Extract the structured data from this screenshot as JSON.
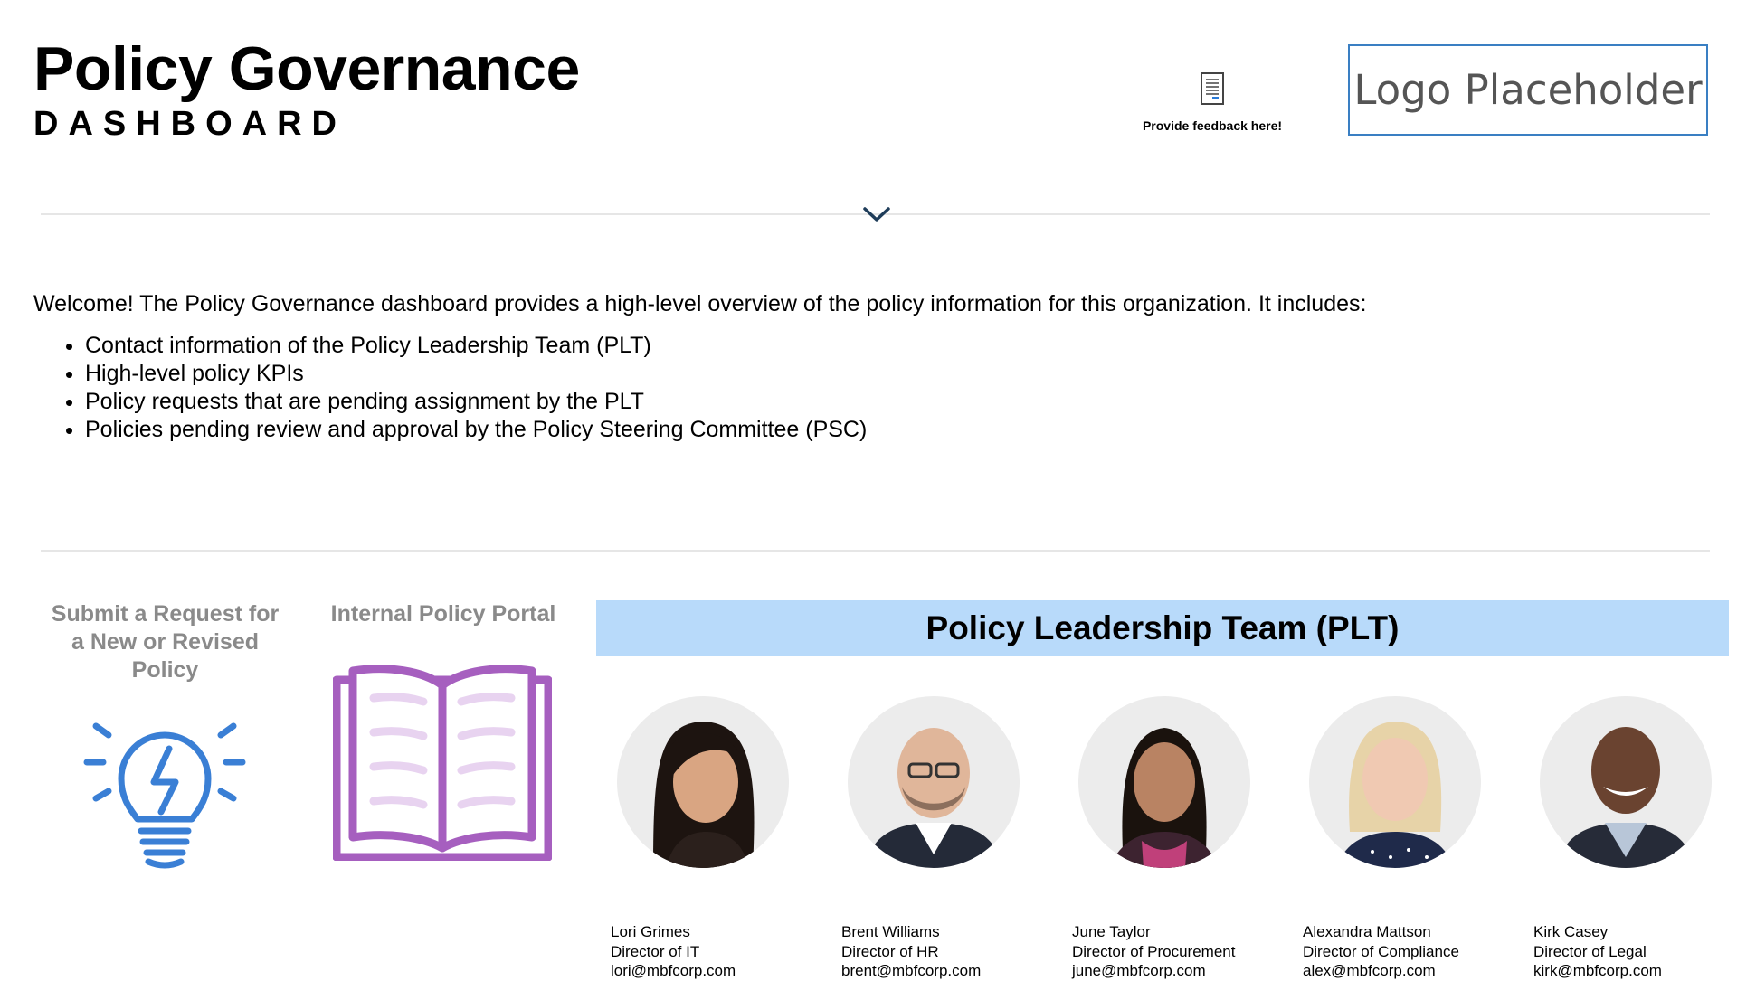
{
  "header": {
    "title": "Policy Governance",
    "subtitle": "DASHBOARD",
    "feedback_label": "Provide feedback here!",
    "logo_text": "Logo Placeholder"
  },
  "intro": {
    "text": "Welcome! The Policy Governance dashboard provides a high-level overview of the policy information for this organization. It includes:",
    "bullets": [
      "Contact information of the Policy Leadership Team (PLT)",
      "High-level policy KPIs",
      "Policy requests that are pending assignment by the PLT",
      "Policies pending review and approval by the Policy Steering Committee (PSC)"
    ]
  },
  "cards": {
    "submit_request": "Submit a Request for a New or Revised Policy",
    "policy_portal": "Internal Policy Portal"
  },
  "plt": {
    "title": "Policy Leadership Team (PLT)",
    "members": [
      {
        "name": "Lori Grimes",
        "role": "Director of IT",
        "email": "lori@mbfcorp.com"
      },
      {
        "name": "Brent Williams",
        "role": "Director of HR",
        "email": "brent@mbfcorp.com"
      },
      {
        "name": "June Taylor",
        "role": "Director of Procurement",
        "email": "june@mbfcorp.com"
      },
      {
        "name": "Alexandra Mattson",
        "role": "Director of Compliance",
        "email": "alex@mbfcorp.com"
      },
      {
        "name": "Kirk Casey",
        "role": "Director of Legal",
        "email": "kirk@mbfcorp.com"
      }
    ]
  },
  "colors": {
    "banner": "#b8dafa",
    "bulb_blue": "#3a7fd5",
    "book_purple": "#a65fbf",
    "logo_border": "#3a7fc3"
  }
}
